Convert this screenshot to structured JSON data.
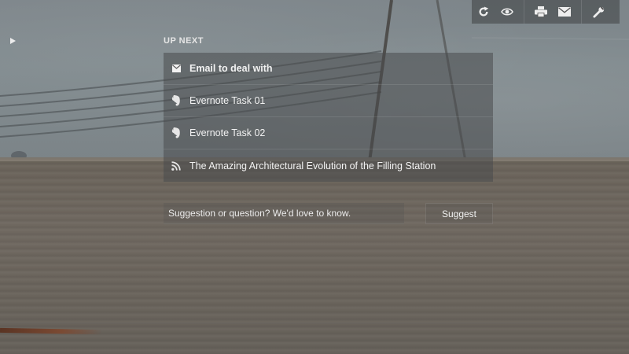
{
  "toolbar": {
    "icons": [
      "refresh-icon",
      "eye-icon",
      "print-icon",
      "mail-icon",
      "wrench-icon"
    ]
  },
  "up_next": {
    "heading": "UP NEXT",
    "items": [
      {
        "icon": "mail-icon",
        "label": "Email to deal with"
      },
      {
        "icon": "evernote-icon",
        "label": "Evernote Task 01"
      },
      {
        "icon": "evernote-icon",
        "label": "Evernote Task 02"
      },
      {
        "icon": "rss-icon",
        "label": "The Amazing Architectural Evolution of the Filling Station"
      }
    ]
  },
  "suggestion": {
    "placeholder": "Suggestion or question? We'd love to know.",
    "button_label": "Suggest"
  },
  "colors": {
    "panel_bg": "#484a4c",
    "text": "#f2f2f2",
    "toolbar_bg": "#46484a"
  }
}
